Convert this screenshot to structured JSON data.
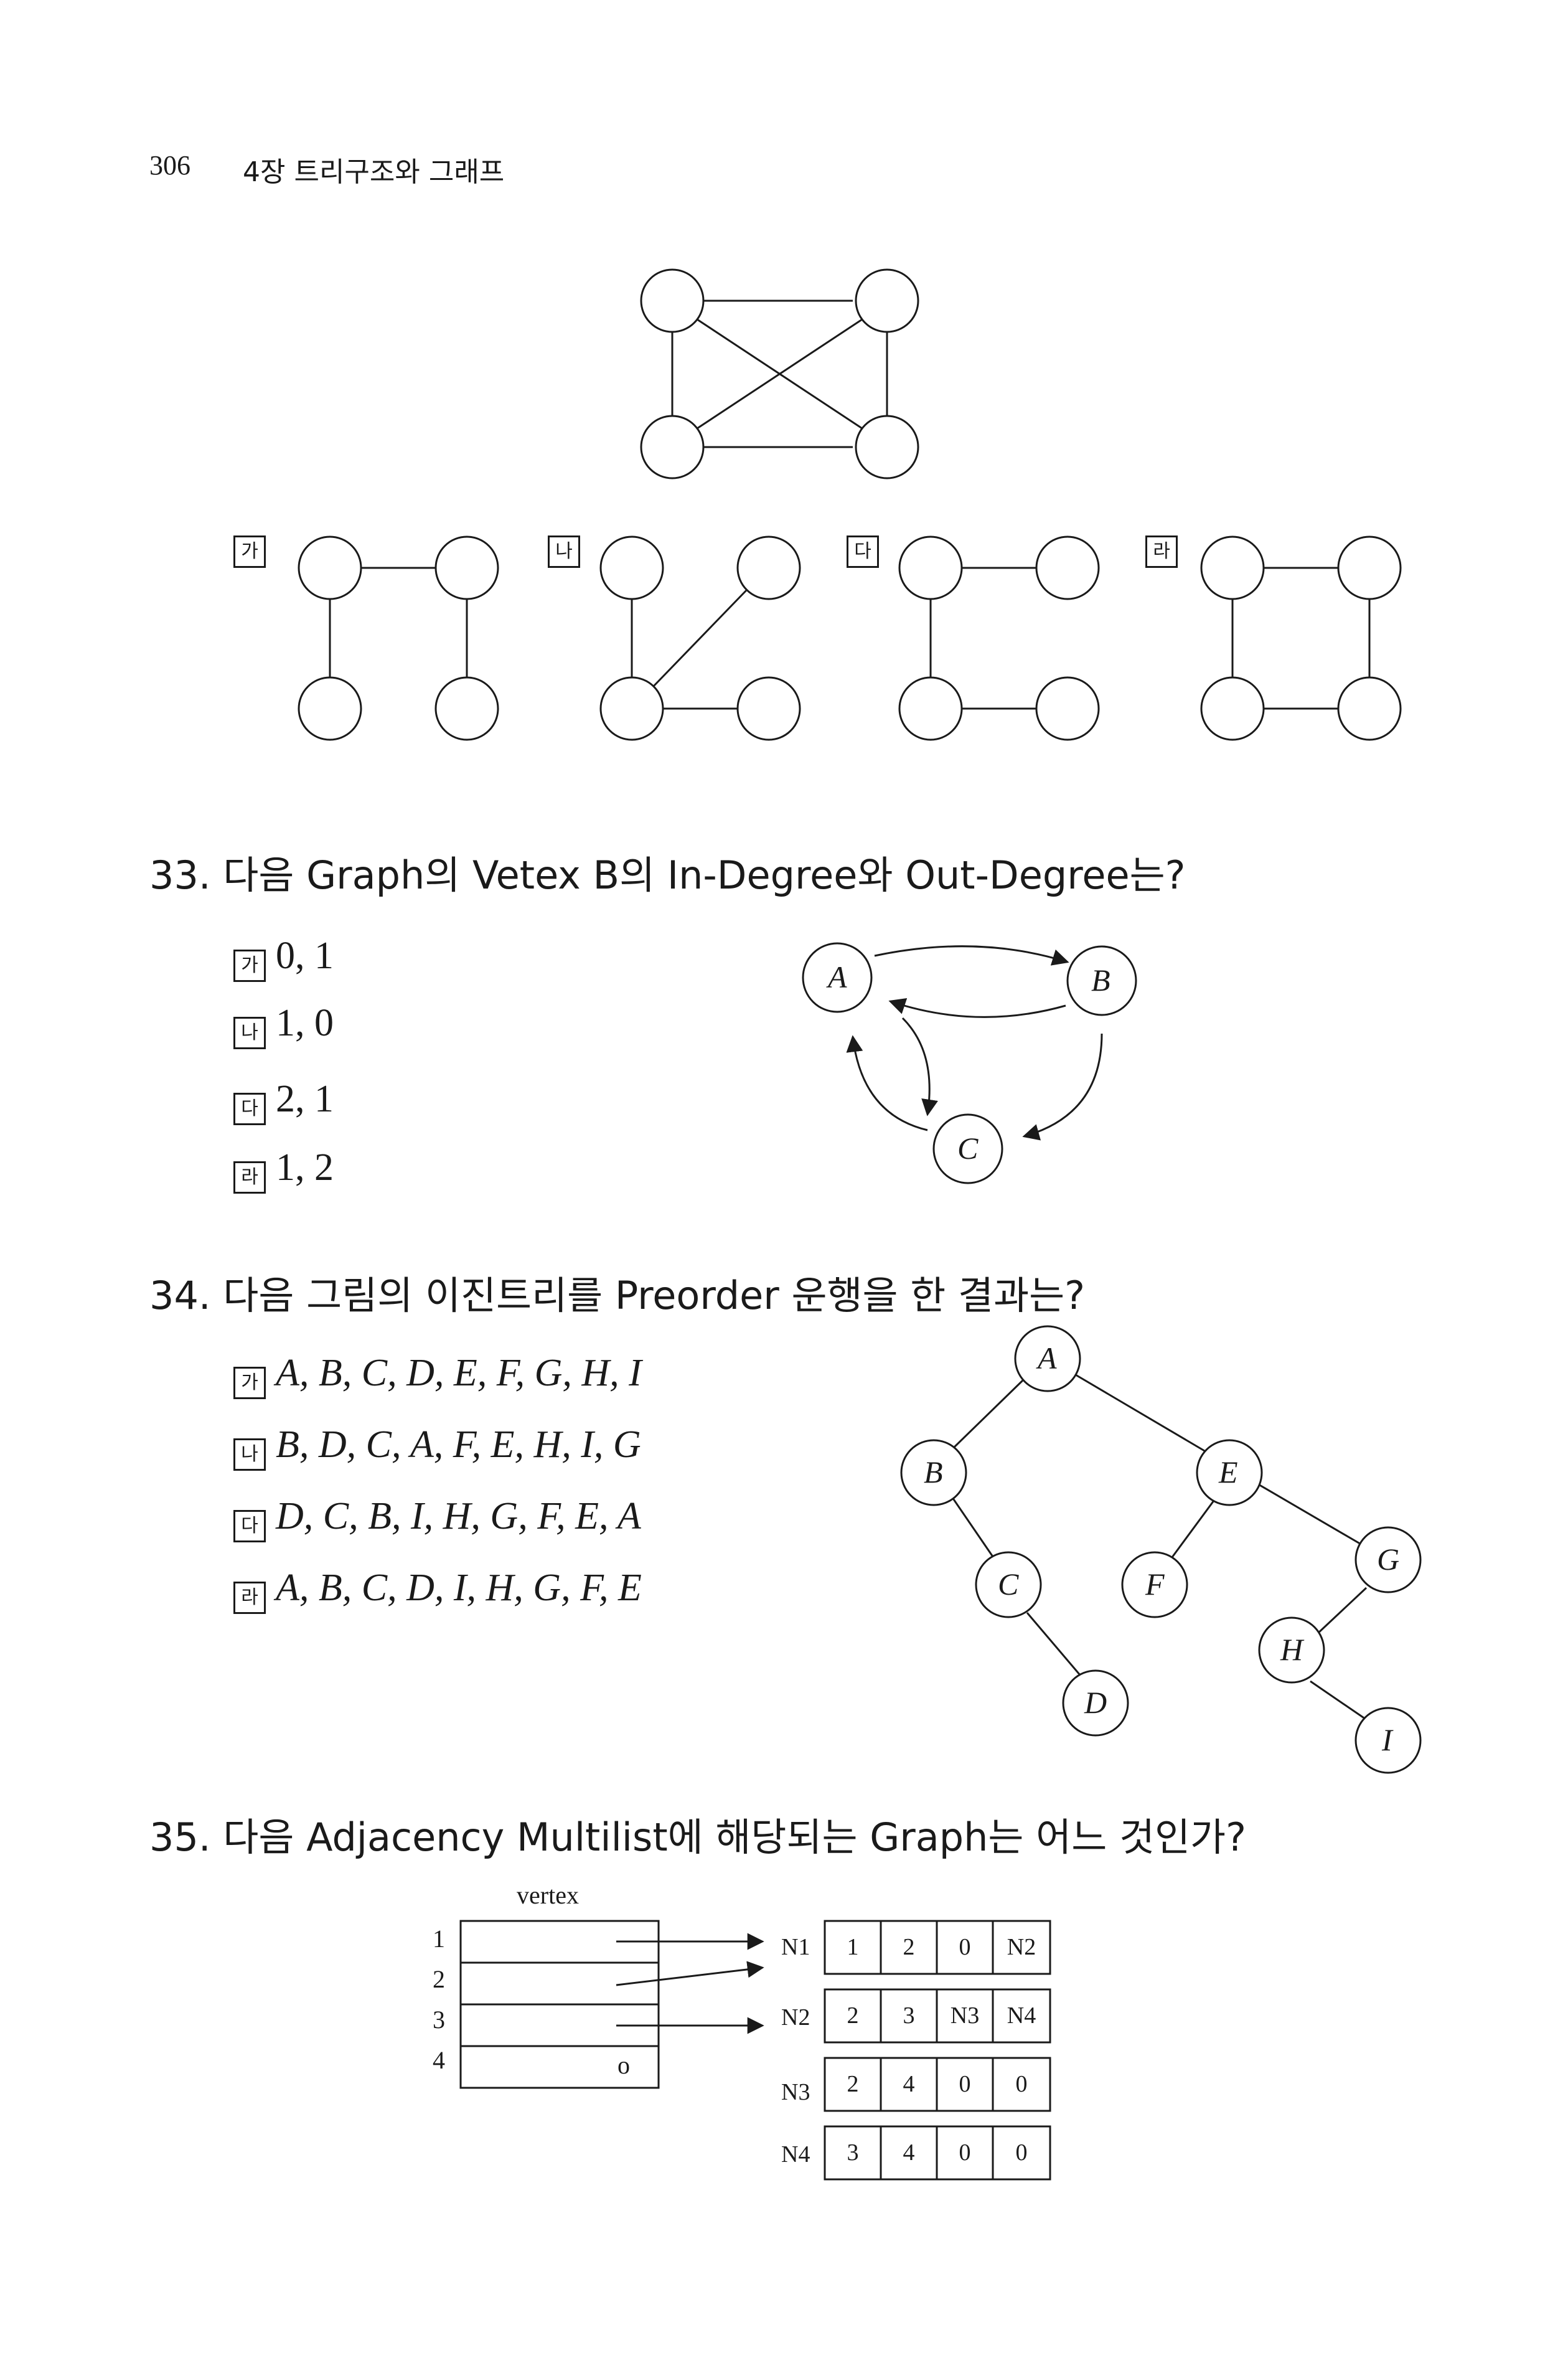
{
  "header": {
    "page_number": "306",
    "chapter": "4장 트리구조와 그래프"
  },
  "q32": {
    "options": [
      {
        "mark": "가"
      },
      {
        "mark": "나"
      },
      {
        "mark": "다"
      },
      {
        "mark": "라"
      }
    ]
  },
  "q33": {
    "number": "33.",
    "title": "다음 Graph의 Vetex B의 In-Degree와 Out-Degree는?",
    "options": [
      {
        "mark": "가",
        "text": "0, 1"
      },
      {
        "mark": "나",
        "text": "1, 0"
      },
      {
        "mark": "다",
        "text": "2, 1"
      },
      {
        "mark": "라",
        "text": "1, 2"
      }
    ],
    "nodes": [
      "A",
      "B",
      "C"
    ]
  },
  "q34": {
    "number": "34.",
    "title": "다음 그림의 이진트리를 Preorder 운행을 한 결과는?",
    "options": [
      {
        "mark": "가",
        "text": "A, B, C, D, E, F, G, H, I"
      },
      {
        "mark": "나",
        "text": "B, D, C, A, F, E, H, I, G"
      },
      {
        "mark": "다",
        "text": "D, C, B, I, H, G, F, E, A"
      },
      {
        "mark": "라",
        "text": "A, B, C, D, I, H, G, F, E"
      }
    ],
    "nodes": [
      "A",
      "B",
      "C",
      "D",
      "E",
      "F",
      "G",
      "H",
      "I"
    ]
  },
  "q35": {
    "number": "35.",
    "title": "다음 Adjacency Multilist에 해당되는 Graph는 어느 것인가?",
    "vertex_label": "vertex",
    "vertex_indices": [
      "1",
      "2",
      "3",
      "4"
    ],
    "null_mark": "o",
    "rows": [
      {
        "name": "N1",
        "cells": [
          "1",
          "2",
          "0",
          "N2"
        ]
      },
      {
        "name": "N2",
        "cells": [
          "2",
          "3",
          "N3",
          "N4"
        ]
      },
      {
        "name": "N3",
        "cells": [
          "2",
          "4",
          "0",
          "0"
        ]
      },
      {
        "name": "N4",
        "cells": [
          "3",
          "4",
          "0",
          "0"
        ]
      }
    ]
  }
}
